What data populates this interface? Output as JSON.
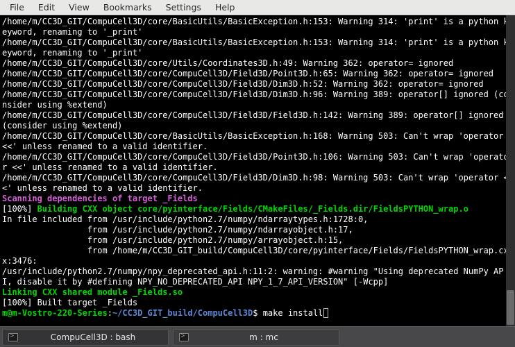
{
  "menubar": {
    "file": "File",
    "edit": "Edit",
    "view": "View",
    "bookmarks": "Bookmarks",
    "settings": "Settings",
    "help": "Help"
  },
  "lines": [
    {
      "cls": "white",
      "text": "/home/m/CC3D_GIT/CompuCell3D/core/BasicUtils/BasicException.h:153: Warning 314: 'print' is a python keyword, renaming to '_print'"
    },
    {
      "cls": "white",
      "text": "/home/m/CC3D_GIT/CompuCell3D/core/BasicUtils/BasicException.h:153: Warning 314: 'print' is a python keyword, renaming to '_print'"
    },
    {
      "cls": "white",
      "text": "/home/m/CC3D_GIT/CompuCell3D/core/Utils/Coordinates3D.h:49: Warning 362: operator= ignored"
    },
    {
      "cls": "white",
      "text": "/home/m/CC3D_GIT/CompuCell3D/core/CompuCell3D/Field3D/Point3D.h:65: Warning 362: operator= ignored"
    },
    {
      "cls": "white",
      "text": "/home/m/CC3D_GIT/CompuCell3D/core/CompuCell3D/Field3D/Dim3D.h:52: Warning 362: operator= ignored"
    },
    {
      "cls": "white",
      "text": "/home/m/CC3D_GIT/CompuCell3D/core/CompuCell3D/Field3D/Dim3D.h:96: Warning 389: operator[] ignored (consider using %extend)"
    },
    {
      "cls": "white",
      "text": "/home/m/CC3D_GIT/CompuCell3D/core/CompuCell3D/Field3D/Field3D.h:142: Warning 389: operator[] ignored (consider using %extend)"
    },
    {
      "cls": "white",
      "text": "/home/m/CC3D_GIT/CompuCell3D/core/BasicUtils/BasicException.h:168: Warning 503: Can't wrap 'operator <<' unless renamed to a valid identifier."
    },
    {
      "cls": "white",
      "text": "/home/m/CC3D_GIT/CompuCell3D/core/CompuCell3D/Field3D/Point3D.h:106: Warning 503: Can't wrap 'operator <<' unless renamed to a valid identifier."
    },
    {
      "cls": "white",
      "text": "/home/m/CC3D_GIT/CompuCell3D/core/CompuCell3D/Field3D/Dim3D.h:98: Warning 503: Can't wrap 'operator <<' unless renamed to a valid identifier."
    },
    {
      "cls": "magenta",
      "text": "Scanning dependencies of target _Fields"
    },
    {
      "segments": [
        {
          "cls": "white",
          "text": "[100%] "
        },
        {
          "cls": "green-bold",
          "text": "Building CXX object core/pyinterface/Fields/CMakeFiles/_Fields.dir/FieldsPYTHON_wrap.o"
        }
      ]
    },
    {
      "cls": "white",
      "text": "In file included from /usr/include/python2.7/numpy/ndarraytypes.h:1728:0,"
    },
    {
      "cls": "white",
      "text": "                 from /usr/include/python2.7/numpy/ndarrayobject.h:17,"
    },
    {
      "cls": "white",
      "text": "                 from /usr/include/python2.7/numpy/arrayobject.h:15,"
    },
    {
      "cls": "white",
      "text": "                 from /home/m/CC3D_GIT_build/CompuCell3D/core/pyinterface/Fields/FieldsPYTHON_wrap.cxx:3476:"
    },
    {
      "cls": "white",
      "text": "/usr/include/python2.7/numpy/npy_deprecated_api.h:11:2: warning: #warning \"Using deprecated NumPy API, disable it by #defining NPY_NO_DEPRECATED_API NPY_1_7_API_VERSION\" [-Wcpp]"
    },
    {
      "cls": "green-bold",
      "text": "Linking CXX shared module _Fields.so"
    },
    {
      "cls": "white",
      "text": "[100%] Built target _Fields"
    }
  ],
  "prompt": {
    "user_host": "m@m-Vostro-220-Series",
    "colon": ":",
    "path": "~/CC3D_GIT_build/CompuCell3D",
    "dollar": "$ ",
    "command": "make install"
  },
  "taskbar": {
    "item1": "CompuCell3D : bash",
    "item2": "m : mc"
  }
}
